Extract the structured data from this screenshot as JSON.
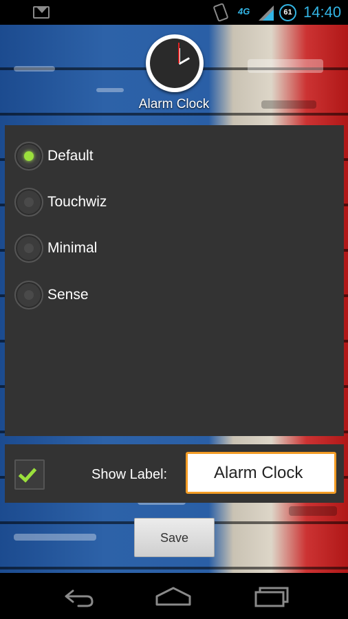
{
  "status_bar": {
    "network_label": "4G",
    "battery_level": "61",
    "time": "14:40",
    "icons": [
      "gmail-icon",
      "vibrate-icon",
      "signal-icon",
      "battery-icon"
    ]
  },
  "header": {
    "app_title": "Alarm Clock",
    "app_icon": "alarm-clock-icon"
  },
  "themes": {
    "options": [
      {
        "label": "Default",
        "checked": true
      },
      {
        "label": "Touchwiz",
        "checked": false
      },
      {
        "label": "Minimal",
        "checked": false
      },
      {
        "label": "Sense",
        "checked": false
      }
    ]
  },
  "label_settings": {
    "show_label_checked": true,
    "show_label_text": "Show Label:",
    "label_value": "Alarm Clock"
  },
  "actions": {
    "save_label": "Save"
  },
  "nav": {
    "icons": [
      "back-icon",
      "home-icon",
      "recent-apps-icon"
    ]
  },
  "colors": {
    "accent_green": "#9be03c",
    "input_focus": "#f39c25",
    "status_blue": "#33b5e5",
    "panel": "#333333"
  }
}
